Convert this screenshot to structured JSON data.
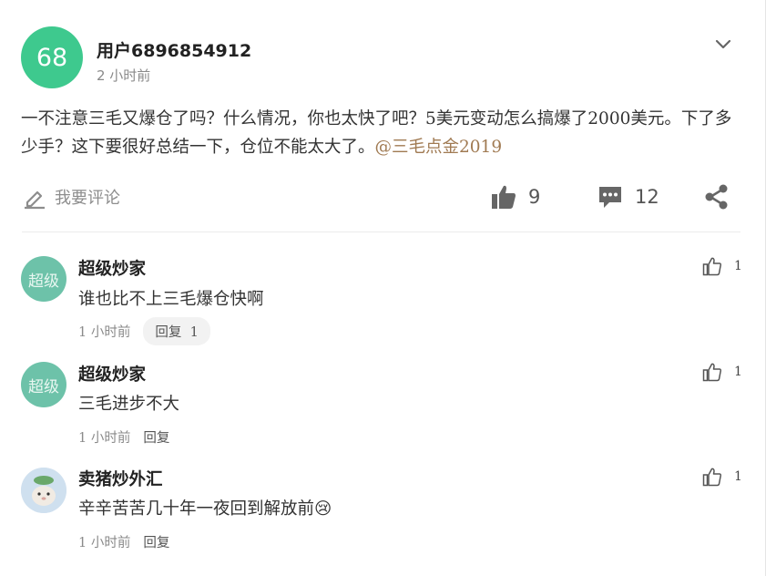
{
  "post": {
    "avatar_text": "68",
    "username": "用户6896854912",
    "time": "2 小时前",
    "content": "一不注意三毛又爆仓了吗？什么情况，你也太快了吧？5美元变动怎么搞爆了2000美元。下了多少手？这下要很好总结一下，仓位不能太大了。",
    "mention": "@三毛点金2019"
  },
  "actions": {
    "comment_placeholder": "我要评论",
    "like_count": "9",
    "comment_count": "12"
  },
  "comments": [
    {
      "avatar_text": "超级",
      "name": "超级炒家",
      "text": "谁也比不上三毛爆仓快啊",
      "time": "1 小时前",
      "reply_label": "回复",
      "reply_count": "1",
      "likes": "1"
    },
    {
      "avatar_text": "超级",
      "name": "超级炒家",
      "text": "三毛进步不大",
      "time": "1 小时前",
      "reply_label": "回复",
      "likes": "1"
    },
    {
      "name": "卖猪炒外汇",
      "text": "辛辛苦苦几十年一夜回到解放前😢",
      "time": "1 小时前",
      "reply_label": "回复",
      "likes": "1"
    }
  ],
  "colors": {
    "accent_green": "#3ec98e",
    "mention": "#a07a52",
    "comment_avatar": "#6dc2a9"
  }
}
